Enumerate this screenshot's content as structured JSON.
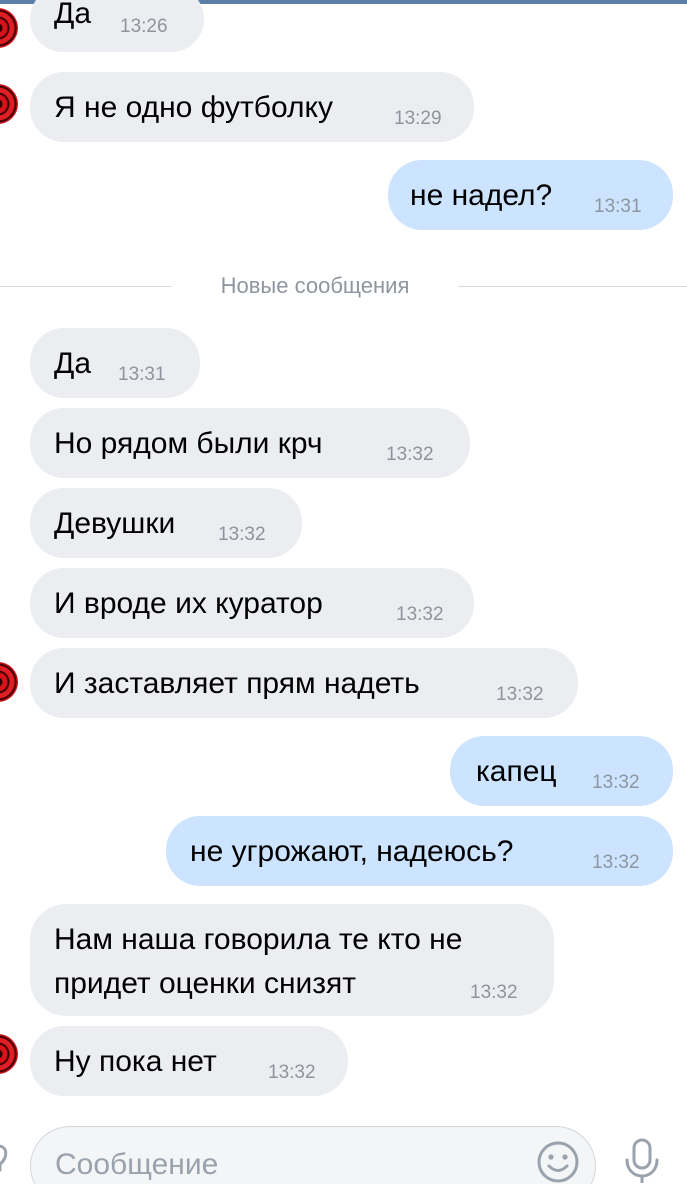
{
  "chat": {
    "divider_label": "Новые сообщения",
    "messages": [
      {
        "text": "Да",
        "time": "13:26"
      },
      {
        "text": "Я не одно футболку",
        "time": "13:29"
      },
      {
        "text": "не надел?",
        "time": "13:31"
      },
      {
        "text": "Да",
        "time": "13:31"
      },
      {
        "text": "Но рядом были крч",
        "time": "13:32"
      },
      {
        "text": "Девушки",
        "time": "13:32"
      },
      {
        "text": "И вроде их куратор",
        "time": "13:32"
      },
      {
        "text": "И заставляет прям надеть",
        "time": "13:32"
      },
      {
        "text": "капец",
        "time": "13:32"
      },
      {
        "text": "не угрожают, надеюсь?",
        "time": "13:32"
      },
      {
        "text_line1": "Нам наша говорила те кто не",
        "text_line2": "придет оценки снизят",
        "time": "13:32"
      },
      {
        "text": "Ну пока нет",
        "time": "13:32"
      }
    ]
  },
  "composer": {
    "placeholder": "Сообщение",
    "emoji_icon": "emoji-smile-icon",
    "mic_icon": "microphone-icon"
  },
  "colors": {
    "incoming_bubble": "#ebedf0",
    "outgoing_bubble": "#cce4ff",
    "time_text": "#8e959e",
    "divider_line": "#d7dade"
  }
}
